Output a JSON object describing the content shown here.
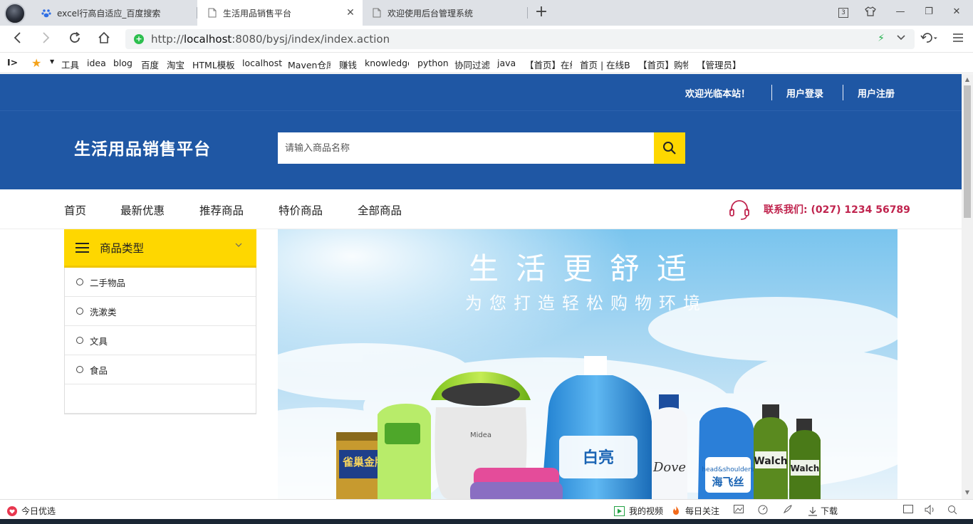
{
  "browser": {
    "tabs": [
      {
        "title": "excel行高自适应_百度搜索",
        "icon": "baidu-paw-icon"
      },
      {
        "title": "生活用品销售平台",
        "icon": "page-icon"
      },
      {
        "title": "欢迎使用后台管理系统",
        "icon": "page-icon"
      }
    ],
    "tab_counter": "3",
    "url_prefix": "http://",
    "url_host": "localhost",
    "url_rest": ":8080/bysj/index/index.action",
    "bookmarks": [
      "工具",
      "idea",
      "blog",
      "百度",
      "淘宝",
      "HTML模板",
      "localhost",
      "Maven仓库",
      "赚钱",
      "knowledge",
      "python",
      "协同过滤",
      "java",
      "【首页】在线",
      "首页 | 在线B",
      "【首页】购物",
      "【管理员】"
    ]
  },
  "site": {
    "welcome": "欢迎光临本站！",
    "login": "用户登录",
    "register": "用户注册",
    "logo": "生活用品销售平台",
    "search_placeholder": "请输入商品名称",
    "nav": [
      "首页",
      "最新优惠",
      "推荐商品",
      "特价商品",
      "全部商品"
    ],
    "contact": "联系我们: (027) 1234 56789",
    "category_title": "商品类型",
    "categories": [
      "二手物品",
      "洗漱类",
      "文具",
      "食品"
    ],
    "banner": {
      "headline": "生活更舒适",
      "tagline": "为您打造轻松购物环境",
      "labels": [
        "雀巢金牌",
        "Midea",
        "Dove",
        "head&shoulders",
        "海飞丝",
        "Walch",
        "白亮"
      ]
    }
  },
  "statusbar": {
    "left": "今日优选",
    "video": "我的视频",
    "follow": "每日关注",
    "download": "下载"
  },
  "colors": {
    "brand_blue": "#1f57a4",
    "accent_yellow": "#fed700",
    "contact_red": "#c0244e"
  }
}
